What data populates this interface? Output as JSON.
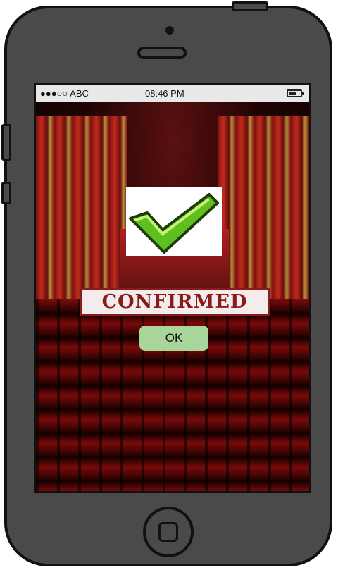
{
  "status_bar": {
    "carrier": "●●●○○ ABC",
    "time": "08:46 PM",
    "battery_level": 0.7
  },
  "dialog": {
    "title": "CONFIRMED",
    "ok_label": "OK",
    "icon": "green-check-icon"
  },
  "colors": {
    "ok_button": "#a9d59b",
    "stamp": "#8b1a1a",
    "check": "#5fbf1f",
    "phone_body": "#4a4a4a"
  }
}
